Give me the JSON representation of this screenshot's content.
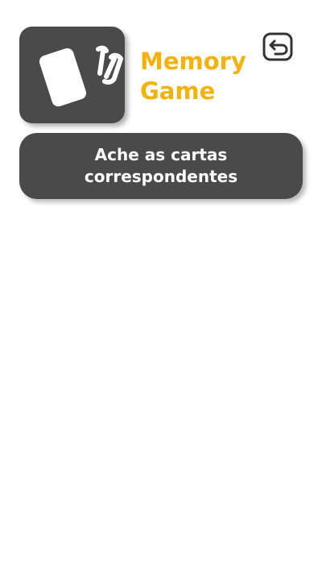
{
  "header": {
    "title_line1": "Memory",
    "title_line2": "Game",
    "logo_icon": "playing-cards-icon",
    "back_icon": "back-arrow-icon"
  },
  "instruction": {
    "text": "Ache as cartas correspondentes"
  },
  "colors": {
    "accent": "#f5b10c",
    "tile": "#4a4a4a",
    "text_on_tile": "#ffffff",
    "background": "#ffffff"
  }
}
